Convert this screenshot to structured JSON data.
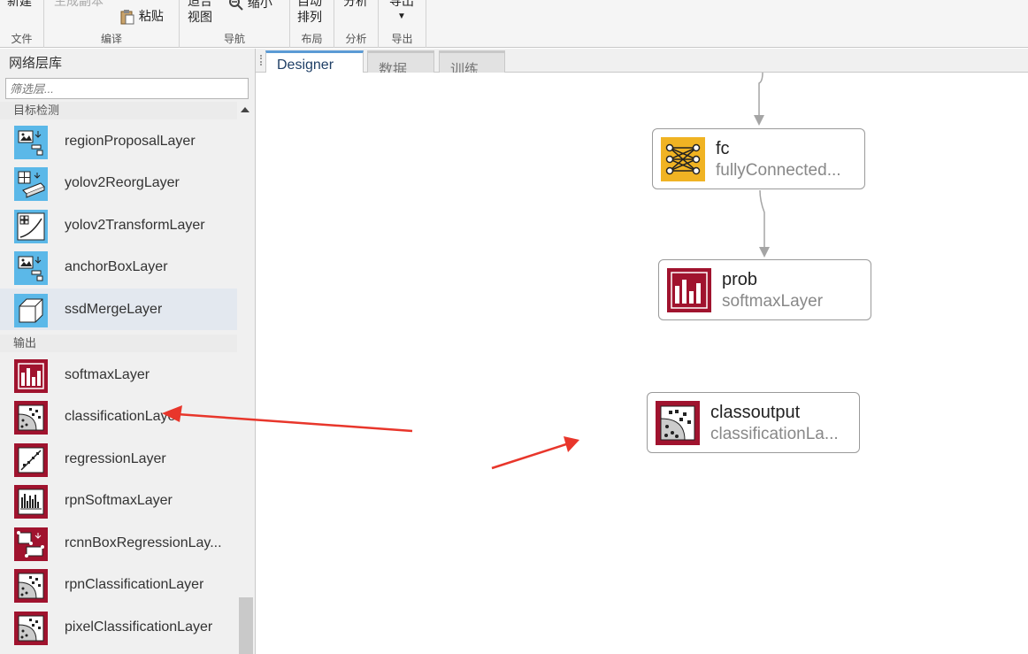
{
  "toolstrip": {
    "file": {
      "new_label": "新建",
      "section": "文件"
    },
    "edit": {
      "duplicate_label": "生成副本",
      "paste_label": "粘贴",
      "section": "编译"
    },
    "navigate": {
      "fit_line1": "适合",
      "fit_line2": "视图",
      "zoom_out_label": "缩小",
      "section": "导航"
    },
    "layout": {
      "auto_line1": "自动",
      "auto_line2": "排列",
      "section": "布局"
    },
    "analyze": {
      "analyze_label": "分析",
      "section": "分析"
    },
    "export": {
      "export_label": "导出",
      "section": "导出"
    }
  },
  "library": {
    "title": "网络层库",
    "filter_placeholder": "筛选层...",
    "categories": [
      {
        "name": "目标检测",
        "items": [
          {
            "label": "regionProposalLayer",
            "icon": "region-proposal-icon"
          },
          {
            "label": "yolov2ReorgLayer",
            "icon": "yolov2-reorg-icon"
          },
          {
            "label": "yolov2TransformLayer",
            "icon": "yolov2-transform-icon"
          },
          {
            "label": "anchorBoxLayer",
            "icon": "anchor-box-icon"
          },
          {
            "label": "ssdMergeLayer",
            "icon": "ssd-merge-icon"
          }
        ]
      },
      {
        "name": "输出",
        "items": [
          {
            "label": "softmaxLayer",
            "icon": "softmax-icon"
          },
          {
            "label": "classificationLayer",
            "icon": "classification-icon"
          },
          {
            "label": "regressionLayer",
            "icon": "regression-icon"
          },
          {
            "label": "rpnSoftmaxLayer",
            "icon": "rpn-softmax-icon"
          },
          {
            "label": "rcnnBoxRegressionLay...",
            "icon": "rcnn-box-regression-icon"
          },
          {
            "label": "rpnClassificationLayer",
            "icon": "rpn-classification-icon"
          },
          {
            "label": "pixelClassificationLayer",
            "icon": "pixel-classification-icon"
          }
        ]
      }
    ]
  },
  "tabs": [
    {
      "label": "Designer",
      "active": true
    },
    {
      "label": "数据",
      "active": false
    },
    {
      "label": "训练",
      "active": false
    }
  ],
  "nodes": {
    "fc": {
      "name": "fc",
      "type": "fullyConnected..."
    },
    "prob": {
      "name": "prob",
      "type": "softmaxLayer"
    },
    "classoutput": {
      "name": "classoutput",
      "type": "classificationLa..."
    }
  },
  "colors": {
    "output_icon_bg": "#a0132e",
    "detection_icon_bg": "#5bb8e8",
    "fc_icon_bg": "#f0b323",
    "annotation_arrow": "#e8362b",
    "active_tab_accent": "#5b9bd5"
  }
}
